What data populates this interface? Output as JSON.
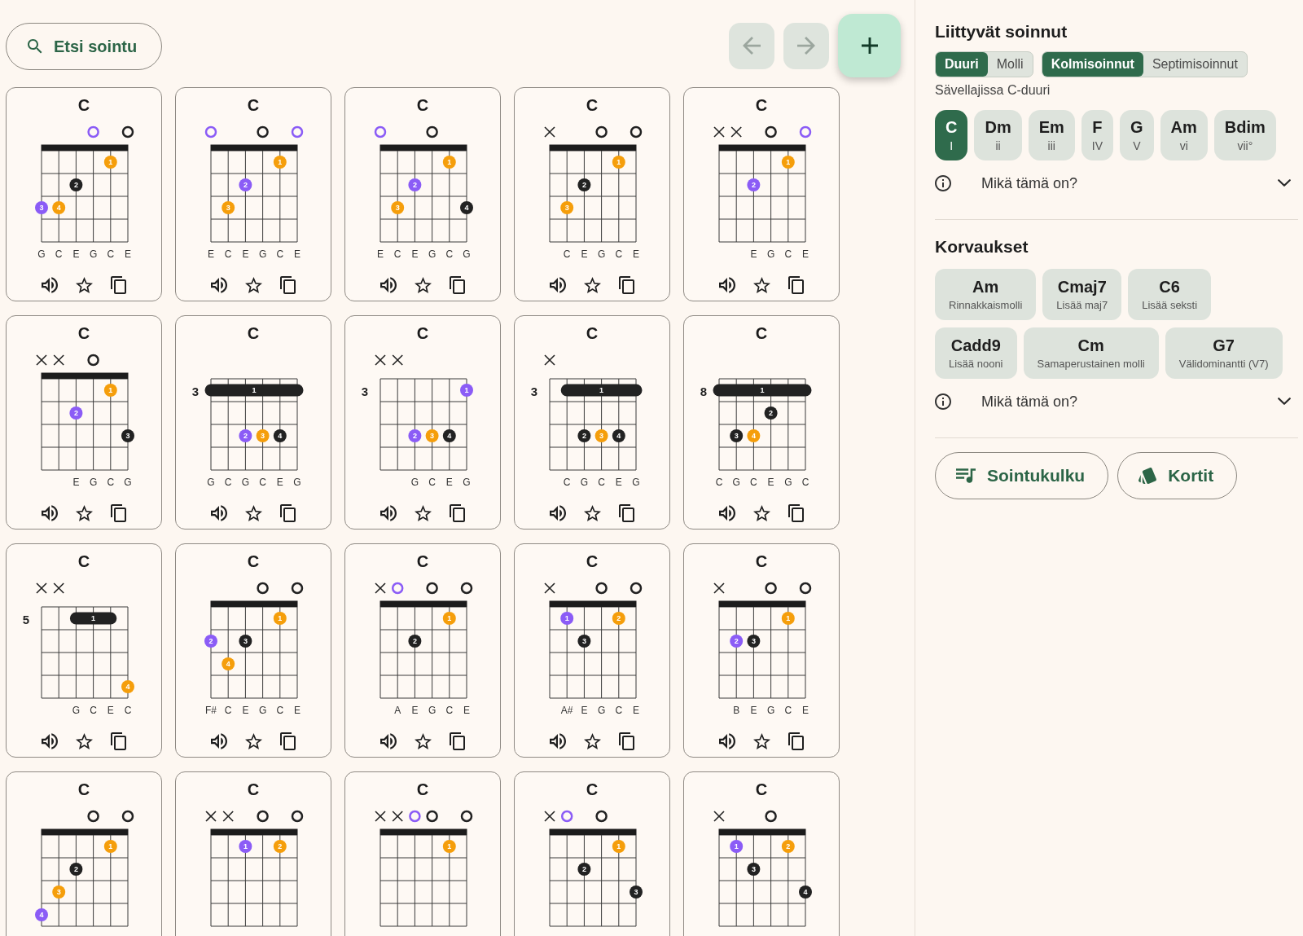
{
  "toolbar": {
    "search": {
      "label": "Etsi sointu"
    },
    "nav": [
      {
        "kind": "back",
        "disabled": true
      },
      {
        "kind": "forward",
        "disabled": true
      }
    ]
  },
  "chords": [
    {
      "name": "C",
      "nut": true,
      "strings": [
        {
          "note": "G",
          "fret_3": {
            "kind": "dot",
            "finger": "3",
            "color": "#8b5cf6"
          }
        },
        {
          "note": "C",
          "fret_3": {
            "kind": "dot",
            "finger": "4",
            "color": "#f59e0b"
          }
        },
        {
          "note": "E",
          "fret_2": {
            "kind": "dot",
            "finger": "2",
            "color": "#222222"
          }
        },
        {
          "top": {
            "kind": "open",
            "color": "#8b5cf6"
          },
          "note": "G"
        },
        {
          "note": "C",
          "fret_1": {
            "kind": "dot",
            "finger": "1",
            "color": "#f59e0b"
          }
        },
        {
          "top": {
            "kind": "open",
            "color": "#222222"
          },
          "note": "E"
        }
      ],
      "actions": [
        {
          "kind": "play"
        },
        {
          "kind": "favorite",
          "on": false
        },
        {
          "kind": "copy"
        }
      ]
    },
    {
      "name": "C",
      "nut": true,
      "strings": [
        {
          "top": {
            "kind": "open",
            "color": "#8b5cf6"
          },
          "note": "E"
        },
        {
          "note": "C",
          "fret_3": {
            "kind": "dot",
            "finger": "3",
            "color": "#f59e0b"
          }
        },
        {
          "note": "E",
          "fret_2": {
            "kind": "dot",
            "finger": "2",
            "color": "#8b5cf6"
          }
        },
        {
          "top": {
            "kind": "open",
            "color": "#222222"
          },
          "note": "G"
        },
        {
          "note": "C",
          "fret_1": {
            "kind": "dot",
            "finger": "1",
            "color": "#f59e0b"
          }
        },
        {
          "top": {
            "kind": "open",
            "color": "#8b5cf6"
          },
          "note": "E"
        }
      ],
      "actions": [
        {
          "kind": "play"
        },
        {
          "kind": "favorite",
          "on": false
        },
        {
          "kind": "copy"
        }
      ]
    },
    {
      "name": "C",
      "nut": true,
      "strings": [
        {
          "top": {
            "kind": "open",
            "color": "#8b5cf6"
          },
          "note": "E"
        },
        {
          "note": "C",
          "fret_3": {
            "kind": "dot",
            "finger": "3",
            "color": "#f59e0b"
          }
        },
        {
          "note": "E",
          "fret_2": {
            "kind": "dot",
            "finger": "2",
            "color": "#8b5cf6"
          }
        },
        {
          "top": {
            "kind": "open",
            "color": "#222222"
          },
          "note": "G"
        },
        {
          "note": "C",
          "fret_1": {
            "kind": "dot",
            "finger": "1",
            "color": "#f59e0b"
          }
        },
        {
          "note": "G",
          "fret_3": {
            "kind": "dot",
            "finger": "4",
            "color": "#222222"
          }
        }
      ],
      "actions": [
        {
          "kind": "play"
        },
        {
          "kind": "favorite",
          "on": false
        },
        {
          "kind": "copy"
        }
      ]
    },
    {
      "name": "C",
      "nut": true,
      "strings": [
        {
          "top": {
            "kind": "muted"
          }
        },
        {
          "note": "C",
          "fret_3": {
            "kind": "dot",
            "finger": "3",
            "color": "#f59e0b"
          }
        },
        {
          "note": "E",
          "fret_2": {
            "kind": "dot",
            "finger": "2",
            "color": "#222222"
          }
        },
        {
          "top": {
            "kind": "open",
            "color": "#222222"
          },
          "note": "G"
        },
        {
          "note": "C",
          "fret_1": {
            "kind": "dot",
            "finger": "1",
            "color": "#f59e0b"
          }
        },
        {
          "top": {
            "kind": "open",
            "color": "#222222"
          },
          "note": "E"
        }
      ],
      "actions": [
        {
          "kind": "play"
        },
        {
          "kind": "favorite",
          "on": false
        },
        {
          "kind": "copy"
        }
      ]
    },
    {
      "name": "C",
      "nut": true,
      "strings": [
        {
          "top": {
            "kind": "muted"
          }
        },
        {
          "top": {
            "kind": "muted"
          }
        },
        {
          "note": "E",
          "fret_2": {
            "kind": "dot",
            "finger": "2",
            "color": "#8b5cf6"
          }
        },
        {
          "top": {
            "kind": "open",
            "color": "#222222"
          },
          "note": "G"
        },
        {
          "note": "C",
          "fret_1": {
            "kind": "dot",
            "finger": "1",
            "color": "#f59e0b"
          }
        },
        {
          "top": {
            "kind": "open",
            "color": "#8b5cf6"
          },
          "note": "E"
        }
      ],
      "actions": [
        {
          "kind": "play"
        },
        {
          "kind": "favorite",
          "on": false
        },
        {
          "kind": "copy"
        }
      ]
    },
    {
      "name": "C",
      "nut": true,
      "strings": [
        {
          "top": {
            "kind": "muted"
          }
        },
        {
          "top": {
            "kind": "muted"
          }
        },
        {
          "note": "E",
          "fret_2": {
            "kind": "dot",
            "finger": "2",
            "color": "#8b5cf6"
          }
        },
        {
          "top": {
            "kind": "open",
            "color": "#222222"
          },
          "note": "G"
        },
        {
          "note": "C",
          "fret_1": {
            "kind": "dot",
            "finger": "1",
            "color": "#f59e0b"
          }
        },
        {
          "note": "G",
          "fret_3": {
            "kind": "dot",
            "finger": "3",
            "color": "#222222"
          }
        }
      ],
      "actions": [
        {
          "kind": "play"
        },
        {
          "kind": "favorite",
          "on": false
        },
        {
          "kind": "copy"
        }
      ]
    },
    {
      "name": "C",
      "nut": false,
      "fret_label": "3",
      "strings": [
        {
          "note": "G",
          "fret_1": {
            "kind": "barre",
            "finger": "1"
          }
        },
        {
          "note": "C",
          "fret_1": {
            "kind": "barre"
          }
        },
        {
          "note": "G",
          "fret_1": {
            "kind": "barre"
          },
          "fret_3": {
            "kind": "dot",
            "finger": "2",
            "color": "#8b5cf6"
          }
        },
        {
          "note": "C",
          "fret_1": {
            "kind": "barre"
          },
          "fret_3": {
            "kind": "dot",
            "finger": "3",
            "color": "#f59e0b"
          }
        },
        {
          "note": "E",
          "fret_1": {
            "kind": "barre"
          },
          "fret_3": {
            "kind": "dot",
            "finger": "4",
            "color": "#222222"
          }
        },
        {
          "note": "G",
          "fret_1": {
            "kind": "barre"
          }
        }
      ],
      "actions": [
        {
          "kind": "play"
        },
        {
          "kind": "favorite",
          "on": false
        },
        {
          "kind": "copy"
        }
      ]
    },
    {
      "name": "C",
      "nut": false,
      "fret_label": "3",
      "strings": [
        {
          "top": {
            "kind": "muted"
          }
        },
        {
          "top": {
            "kind": "muted"
          }
        },
        {
          "note": "G",
          "fret_3": {
            "kind": "dot",
            "finger": "2",
            "color": "#8b5cf6"
          }
        },
        {
          "note": "C",
          "fret_3": {
            "kind": "dot",
            "finger": "3",
            "color": "#f59e0b"
          }
        },
        {
          "note": "E",
          "fret_3": {
            "kind": "dot",
            "finger": "4",
            "color": "#222222"
          }
        },
        {
          "note": "G",
          "fret_1": {
            "kind": "dot",
            "finger": "1",
            "color": "#8b5cf6"
          }
        }
      ],
      "actions": [
        {
          "kind": "play"
        },
        {
          "kind": "favorite",
          "on": false
        },
        {
          "kind": "copy"
        }
      ]
    },
    {
      "name": "C",
      "nut": false,
      "fret_label": "3",
      "strings": [
        {
          "top": {
            "kind": "muted"
          }
        },
        {
          "note": "C",
          "fret_1": {
            "kind": "barre",
            "finger": "1"
          }
        },
        {
          "note": "G",
          "fret_1": {
            "kind": "barre"
          },
          "fret_3": {
            "kind": "dot",
            "finger": "2",
            "color": "#222222"
          }
        },
        {
          "note": "C",
          "fret_1": {
            "kind": "barre"
          },
          "fret_3": {
            "kind": "dot",
            "finger": "3",
            "color": "#f59e0b"
          }
        },
        {
          "note": "E",
          "fret_1": {
            "kind": "barre"
          },
          "fret_3": {
            "kind": "dot",
            "finger": "4",
            "color": "#222222"
          }
        },
        {
          "note": "G",
          "fret_1": {
            "kind": "barre"
          }
        }
      ],
      "actions": [
        {
          "kind": "play"
        },
        {
          "kind": "favorite",
          "on": false
        },
        {
          "kind": "copy"
        }
      ]
    },
    {
      "name": "C",
      "nut": false,
      "fret_label": "8",
      "strings": [
        {
          "note": "C",
          "fret_1": {
            "kind": "barre",
            "finger": "1"
          }
        },
        {
          "note": "G",
          "fret_1": {
            "kind": "barre"
          },
          "fret_3": {
            "kind": "dot",
            "finger": "3",
            "color": "#222222"
          }
        },
        {
          "note": "C",
          "fret_1": {
            "kind": "barre"
          },
          "fret_3": {
            "kind": "dot",
            "finger": "4",
            "color": "#f59e0b"
          }
        },
        {
          "note": "E",
          "fret_1": {
            "kind": "barre"
          },
          "fret_2": {
            "kind": "dot",
            "finger": "2",
            "color": "#222222"
          }
        },
        {
          "note": "G",
          "fret_1": {
            "kind": "barre"
          }
        },
        {
          "note": "C",
          "fret_1": {
            "kind": "barre"
          }
        }
      ],
      "actions": [
        {
          "kind": "play"
        },
        {
          "kind": "favorite",
          "on": false
        },
        {
          "kind": "copy"
        }
      ]
    },
    {
      "name": "C",
      "nut": false,
      "fret_label": "5",
      "strings": [
        {
          "top": {
            "kind": "muted"
          }
        },
        {
          "top": {
            "kind": "muted"
          }
        },
        {
          "note": "G",
          "fret_1": {
            "kind": "barre",
            "finger": "1"
          }
        },
        {
          "note": "C",
          "fret_1": {
            "kind": "barre"
          }
        },
        {
          "note": "E",
          "fret_1": {
            "kind": "barre"
          }
        },
        {
          "note": "C",
          "fret_4": {
            "kind": "dot",
            "finger": "4",
            "color": "#f59e0b"
          }
        }
      ],
      "actions": [
        {
          "kind": "play"
        },
        {
          "kind": "favorite",
          "on": false
        },
        {
          "kind": "copy"
        }
      ]
    },
    {
      "name": "C",
      "nut": true,
      "strings": [
        {
          "note": "F#",
          "fret_2": {
            "kind": "dot",
            "finger": "2",
            "color": "#8b5cf6"
          }
        },
        {
          "note": "C",
          "fret_3": {
            "kind": "dot",
            "finger": "4",
            "color": "#f59e0b"
          }
        },
        {
          "note": "E",
          "fret_2": {
            "kind": "dot",
            "finger": "3",
            "color": "#222222"
          }
        },
        {
          "top": {
            "kind": "open",
            "color": "#222222"
          },
          "note": "G"
        },
        {
          "note": "C",
          "fret_1": {
            "kind": "dot",
            "finger": "1",
            "color": "#f59e0b"
          }
        },
        {
          "top": {
            "kind": "open",
            "color": "#222222"
          },
          "note": "E"
        }
      ],
      "actions": [
        {
          "kind": "play"
        },
        {
          "kind": "favorite",
          "on": false
        },
        {
          "kind": "copy"
        }
      ]
    },
    {
      "name": "C",
      "nut": true,
      "strings": [
        {
          "top": {
            "kind": "muted"
          }
        },
        {
          "top": {
            "kind": "open",
            "color": "#8b5cf6"
          },
          "note": "A"
        },
        {
          "note": "E",
          "fret_2": {
            "kind": "dot",
            "finger": "2",
            "color": "#222222"
          }
        },
        {
          "top": {
            "kind": "open",
            "color": "#222222"
          },
          "note": "G"
        },
        {
          "note": "C",
          "fret_1": {
            "kind": "dot",
            "finger": "1",
            "color": "#f59e0b"
          }
        },
        {
          "top": {
            "kind": "open",
            "color": "#222222"
          },
          "note": "E"
        }
      ],
      "actions": [
        {
          "kind": "play"
        },
        {
          "kind": "favorite",
          "on": false
        },
        {
          "kind": "copy"
        }
      ]
    },
    {
      "name": "C",
      "nut": true,
      "strings": [
        {
          "top": {
            "kind": "muted"
          }
        },
        {
          "note": "A#",
          "fret_1": {
            "kind": "dot",
            "finger": "1",
            "color": "#8b5cf6"
          }
        },
        {
          "note": "E",
          "fret_2": {
            "kind": "dot",
            "finger": "3",
            "color": "#222222"
          }
        },
        {
          "top": {
            "kind": "open",
            "color": "#222222"
          },
          "note": "G"
        },
        {
          "note": "C",
          "fret_1": {
            "kind": "dot",
            "finger": "2",
            "color": "#f59e0b"
          }
        },
        {
          "top": {
            "kind": "open",
            "color": "#222222"
          },
          "note": "E"
        }
      ],
      "actions": [
        {
          "kind": "play"
        },
        {
          "kind": "favorite",
          "on": false
        },
        {
          "kind": "copy"
        }
      ]
    },
    {
      "name": "C",
      "nut": true,
      "strings": [
        {
          "top": {
            "kind": "muted"
          }
        },
        {
          "note": "B",
          "fret_2": {
            "kind": "dot",
            "finger": "2",
            "color": "#8b5cf6"
          }
        },
        {
          "note": "E",
          "fret_2": {
            "kind": "dot",
            "finger": "3",
            "color": "#222222"
          }
        },
        {
          "top": {
            "kind": "open",
            "color": "#222222"
          },
          "note": "G"
        },
        {
          "note": "C",
          "fret_1": {
            "kind": "dot",
            "finger": "1",
            "color": "#f59e0b"
          }
        },
        {
          "top": {
            "kind": "open",
            "color": "#222222"
          },
          "note": "E"
        }
      ],
      "actions": [
        {
          "kind": "play"
        },
        {
          "kind": "favorite",
          "on": false
        },
        {
          "kind": "copy"
        }
      ]
    },
    {
      "name": "C",
      "nut": true,
      "strings": [
        {
          "fret_4": {
            "kind": "dot",
            "finger": "4",
            "color": "#8b5cf6"
          }
        },
        {
          "fret_3": {
            "kind": "dot",
            "finger": "3",
            "color": "#f59e0b"
          }
        },
        {
          "fret_2": {
            "kind": "dot",
            "finger": "2",
            "color": "#222222"
          }
        },
        {
          "top": {
            "kind": "open",
            "color": "#222222"
          }
        },
        {
          "fret_1": {
            "kind": "dot",
            "finger": "1",
            "color": "#f59e0b"
          }
        },
        {
          "top": {
            "kind": "open",
            "color": "#222222"
          }
        }
      ]
    },
    {
      "name": "C",
      "nut": true,
      "strings": [
        {
          "top": {
            "kind": "muted"
          }
        },
        {
          "top": {
            "kind": "muted"
          }
        },
        {
          "fret_1": {
            "kind": "dot",
            "finger": "1",
            "color": "#8b5cf6"
          }
        },
        {
          "top": {
            "kind": "open",
            "color": "#222222"
          }
        },
        {
          "fret_1": {
            "kind": "dot",
            "finger": "2",
            "color": "#f59e0b"
          }
        },
        {
          "top": {
            "kind": "open",
            "color": "#222222"
          }
        }
      ]
    },
    {
      "name": "C",
      "nut": true,
      "strings": [
        {
          "top": {
            "kind": "muted"
          }
        },
        {
          "top": {
            "kind": "muted"
          }
        },
        {
          "top": {
            "kind": "open",
            "color": "#8b5cf6"
          }
        },
        {
          "top": {
            "kind": "open",
            "color": "#222222"
          }
        },
        {
          "fret_1": {
            "kind": "dot",
            "finger": "1",
            "color": "#f59e0b"
          }
        },
        {
          "top": {
            "kind": "open",
            "color": "#222222"
          }
        }
      ]
    },
    {
      "name": "C",
      "nut": true,
      "strings": [
        {
          "top": {
            "kind": "muted"
          }
        },
        {
          "top": {
            "kind": "open",
            "color": "#8b5cf6"
          }
        },
        {
          "fret_2": {
            "kind": "dot",
            "finger": "2",
            "color": "#222222"
          }
        },
        {
          "top": {
            "kind": "open",
            "color": "#222222"
          }
        },
        {
          "fret_1": {
            "kind": "dot",
            "finger": "1",
            "color": "#f59e0b"
          }
        },
        {
          "fret_3": {
            "kind": "dot",
            "finger": "3",
            "color": "#222222"
          }
        }
      ]
    },
    {
      "name": "C",
      "nut": true,
      "strings": [
        {
          "top": {
            "kind": "muted"
          }
        },
        {
          "fret_1": {
            "kind": "dot",
            "finger": "1",
            "color": "#8b5cf6"
          }
        },
        {
          "fret_2": {
            "kind": "dot",
            "finger": "3",
            "color": "#222222"
          }
        },
        {
          "top": {
            "kind": "open",
            "color": "#222222"
          }
        },
        {
          "fret_1": {
            "kind": "dot",
            "finger": "2",
            "color": "#f59e0b"
          }
        },
        {
          "fret_3": {
            "kind": "dot",
            "finger": "4",
            "color": "#222222"
          }
        }
      ]
    }
  ],
  "panel": {
    "related": {
      "title": "Liittyvät soinnut",
      "toggle_groups": [
        {
          "options": [
            {
              "label": "Duuri",
              "selected": true
            },
            {
              "label": "Molli",
              "selected": false
            }
          ]
        },
        {
          "options": [
            {
              "label": "Kolmisoinnut",
              "selected": true
            },
            {
              "label": "Septimisoinnut",
              "selected": false
            }
          ]
        }
      ],
      "caption": "Sävellajissa C-duuri",
      "chords": [
        {
          "name": "C",
          "degree": "I",
          "selected": true
        },
        {
          "name": "Dm",
          "degree": "ii",
          "selected": false
        },
        {
          "name": "Em",
          "degree": "iii",
          "selected": false
        },
        {
          "name": "F",
          "degree": "IV",
          "selected": false
        },
        {
          "name": "G",
          "degree": "V",
          "selected": false
        },
        {
          "name": "Am",
          "degree": "vi",
          "selected": false
        },
        {
          "name": "Bdim",
          "degree": "vii°",
          "selected": false
        }
      ],
      "help": {
        "label": "Mikä tämä on?",
        "expanded": false
      }
    },
    "substitutions": {
      "title": "Korvaukset",
      "chords": [
        {
          "name": "Am",
          "description": "Rinnakkaismolli"
        },
        {
          "name": "Cmaj7",
          "description": "Lisää maj7"
        },
        {
          "name": "C6",
          "description": "Lisää seksti"
        },
        {
          "name": "Cadd9",
          "description": "Lisää nooni"
        },
        {
          "name": "Cm",
          "description": "Samaperustainen molli"
        },
        {
          "name": "G7",
          "description": "Välidominantti (V7)"
        }
      ],
      "help": {
        "label": "Mikä tämä on?",
        "expanded": false
      }
    },
    "buttons": [
      {
        "kind": "progression",
        "label": "Sointukulku"
      },
      {
        "kind": "cards",
        "label": "Kortit"
      }
    ]
  }
}
